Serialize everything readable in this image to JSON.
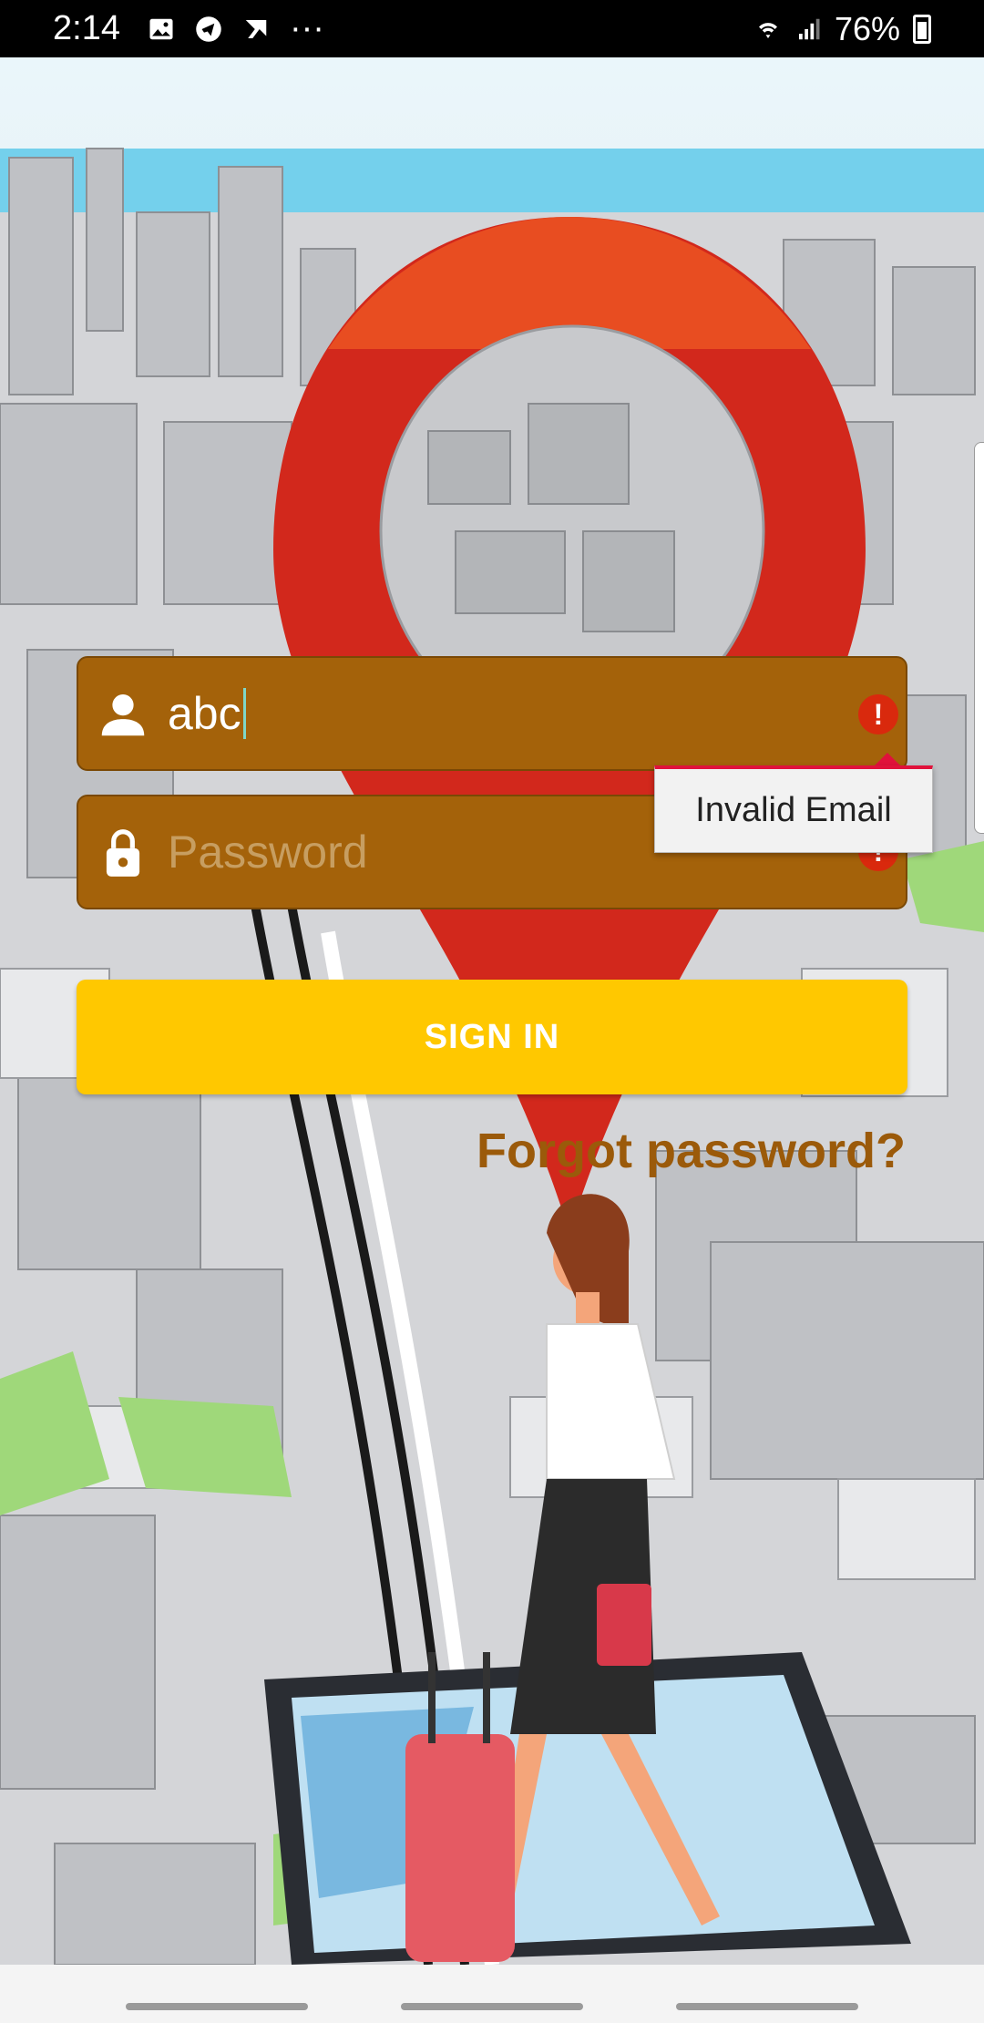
{
  "status_bar": {
    "time": "2:14",
    "left_icons": [
      "gallery-icon",
      "telegram-icon",
      "notification-icon",
      "more-dots"
    ],
    "more": "···",
    "battery_percent": "76%"
  },
  "login": {
    "email_value": "abc",
    "password_placeholder": "Password",
    "error_badge": "!",
    "error_message": "Invalid Email",
    "signin_label": "SIGN IN",
    "forgot_label": "Forgot password?"
  },
  "colors": {
    "field_bg": "#a4620a",
    "button_bg": "#ffc800",
    "forgot_text": "#9b5a0a",
    "error": "#d9290d"
  }
}
